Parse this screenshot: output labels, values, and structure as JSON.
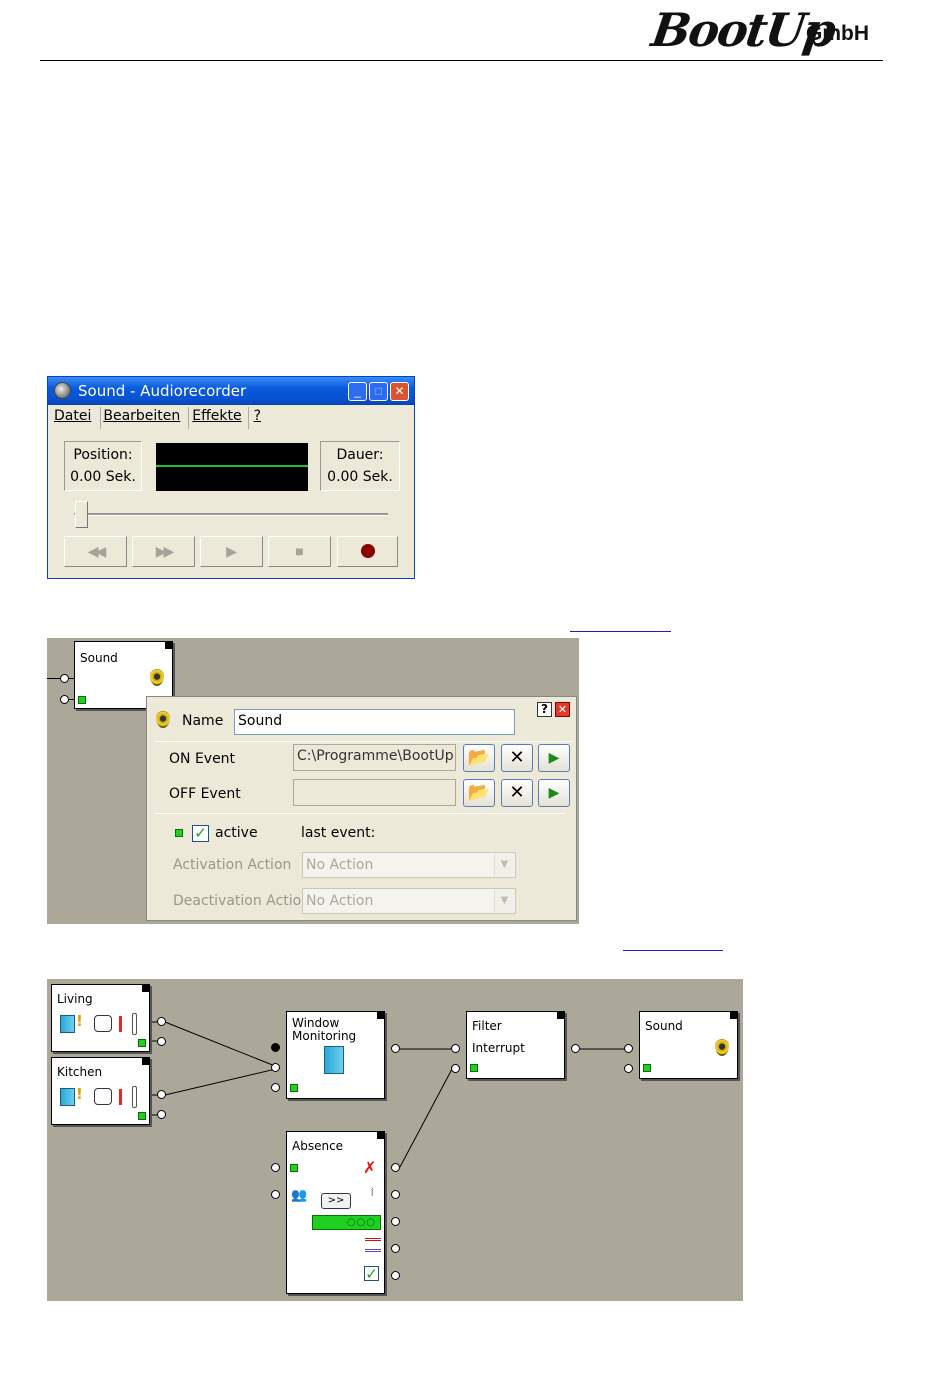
{
  "header": {
    "logo": "BootUp",
    "logo_suffix": "GmbH"
  },
  "recorder": {
    "title": "Sound - Audiorecorder",
    "menu": [
      "Datei",
      "Bearbeiten",
      "Effekte",
      "?"
    ],
    "position_label": "Position:",
    "position_value": "0.00 Sek.",
    "duration_label": "Dauer:",
    "duration_value": "0.00 Sek.",
    "slider_position": 0,
    "transport_buttons": [
      "rewind",
      "fast-forward",
      "play",
      "stop",
      "record"
    ]
  },
  "sound_editor": {
    "block_label": "Sound",
    "name_label": "Name",
    "name_value": "Sound",
    "on_event_label": "ON Event",
    "on_event_value": "C:\\Programme\\BootUp",
    "off_event_label": "OFF Event",
    "off_event_value": "",
    "active_label": "active",
    "active_checked": true,
    "last_event_label": "last event:",
    "activation_label": "Activation Action",
    "activation_value": "No Action",
    "deactivation_label": "Deactivation Action",
    "deactivation_value": "No Action",
    "help_label": "?"
  },
  "flow": {
    "living_label": "Living",
    "kitchen_label": "Kitchen",
    "window_label_1": "Window",
    "window_label_2": "Monitoring",
    "filter_label": "Filter",
    "filter_interrupt": "Interrupt",
    "sound_label": "Sound",
    "absence_label": "Absence",
    "absence_button": ">>"
  },
  "colors": {
    "canvas": "#aca899",
    "titlebar": "#0a5bdd",
    "led_green": "#1fd01f"
  }
}
